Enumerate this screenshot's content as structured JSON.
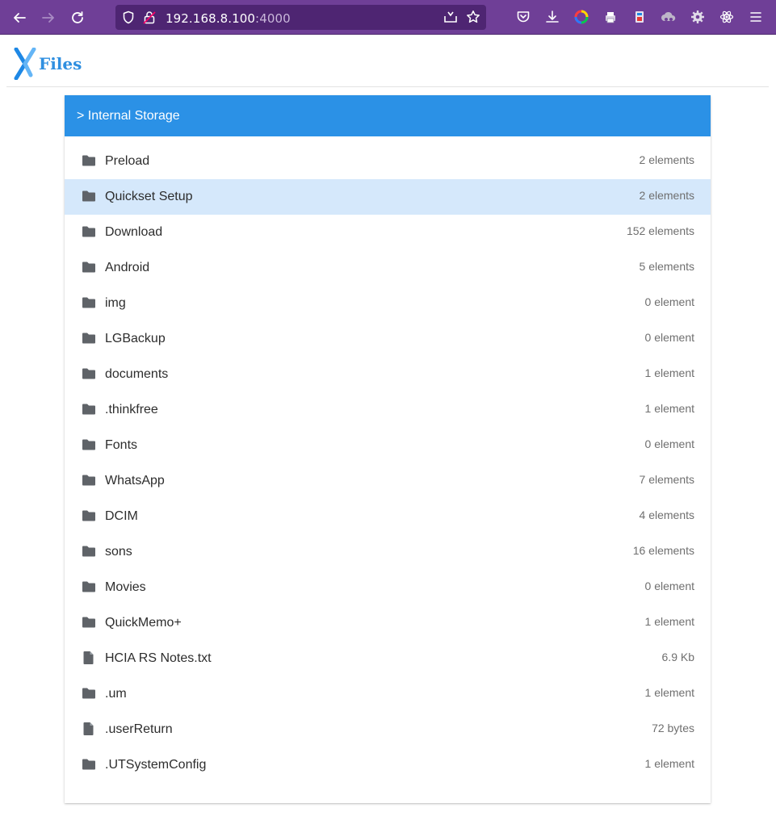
{
  "browser": {
    "url_host": "192.168.8.100",
    "url_port": ":4000"
  },
  "app": {
    "logo_text": "Files"
  },
  "breadcrumb": "> Internal Storage",
  "items": [
    {
      "name": "Preload",
      "meta": "2 elements",
      "type": "folder"
    },
    {
      "name": "Quickset Setup",
      "meta": "2 elements",
      "type": "folder",
      "selected": true
    },
    {
      "name": "Download",
      "meta": "152 elements",
      "type": "folder"
    },
    {
      "name": "Android",
      "meta": "5 elements",
      "type": "folder"
    },
    {
      "name": "img",
      "meta": "0 element",
      "type": "folder"
    },
    {
      "name": "LGBackup",
      "meta": "0 element",
      "type": "folder"
    },
    {
      "name": "documents",
      "meta": "1 element",
      "type": "folder"
    },
    {
      "name": ".thinkfree",
      "meta": "1 element",
      "type": "folder"
    },
    {
      "name": "Fonts",
      "meta": "0 element",
      "type": "folder"
    },
    {
      "name": "WhatsApp",
      "meta": "7 elements",
      "type": "folder"
    },
    {
      "name": "DCIM",
      "meta": "4 elements",
      "type": "folder"
    },
    {
      "name": "sons",
      "meta": "16 elements",
      "type": "folder"
    },
    {
      "name": "Movies",
      "meta": "0 element",
      "type": "folder"
    },
    {
      "name": "QuickMemo+",
      "meta": "1 element",
      "type": "folder"
    },
    {
      "name": "HCIA RS Notes.txt",
      "meta": "6.9 Kb",
      "type": "file"
    },
    {
      "name": ".um",
      "meta": "1 element",
      "type": "folder"
    },
    {
      "name": ".userReturn",
      "meta": "72 bytes",
      "type": "file"
    },
    {
      "name": ".UTSystemConfig",
      "meta": "1 element",
      "type": "folder"
    }
  ],
  "colors": {
    "chrome": "#6f3f97",
    "header": "#2b91e6",
    "selected_row": "#d5e8fb"
  },
  "icons": {
    "folder": "folder-icon",
    "file": "file-icon"
  }
}
